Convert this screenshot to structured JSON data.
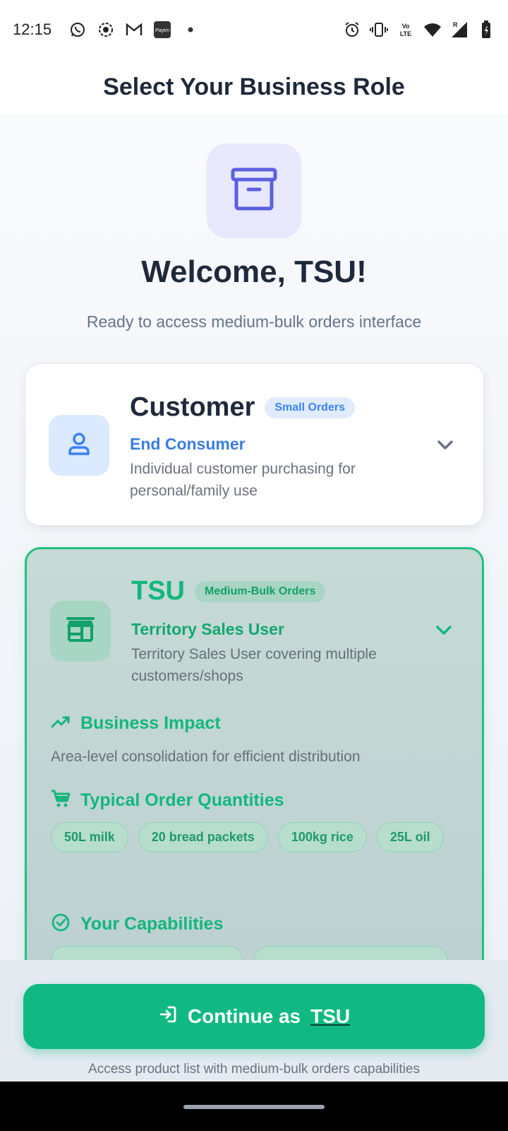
{
  "status_bar": {
    "time": "12:15",
    "left_icons": [
      "whatsapp-icon",
      "screen-record-icon",
      "gmail-icon",
      "paytm-icon",
      "dot-icon"
    ],
    "right_icons": [
      "alarm-icon",
      "vibrate-icon",
      "volte-icon",
      "wifi-icon",
      "signal-icon",
      "battery-icon"
    ],
    "paytm_label": "Paytm",
    "volte_label": "Vo LTE",
    "roaming_label": "R"
  },
  "app_bar": {
    "title": "Select Your Business Role"
  },
  "hero": {
    "icon": "archive-box-icon",
    "welcome": "Welcome, TSU!",
    "subtitle": "Ready to access medium-bulk orders interface"
  },
  "roles": [
    {
      "name": "Customer",
      "badge": "Small Orders",
      "subtitle": "End Consumer",
      "description": "Individual customer purchasing for personal/family use",
      "icon": "user-icon",
      "selected": false
    },
    {
      "name": "TSU",
      "badge": "Medium-Bulk Orders",
      "subtitle": "Territory Sales User",
      "description": "Territory Sales User covering multiple customers/shops",
      "icon": "store-icon",
      "selected": true,
      "business_impact_title": "Business Impact",
      "business_impact_text": "Area-level consolidation for efficient distribution",
      "quantities_title": "Typical Order Quantities",
      "quantities": [
        "50L milk",
        "20 bread packets",
        "100kg rice",
        "25L oil"
      ],
      "capabilities_title": "Your Capabilities"
    }
  ],
  "footer": {
    "button_prefix": "Continue as",
    "button_role": "TSU",
    "note": "Access product list with medium-bulk orders capabilities"
  },
  "colors": {
    "accent_green": "#10b981",
    "accent_blue": "#3b82f6",
    "hero_icon": "#5b5fe0"
  }
}
